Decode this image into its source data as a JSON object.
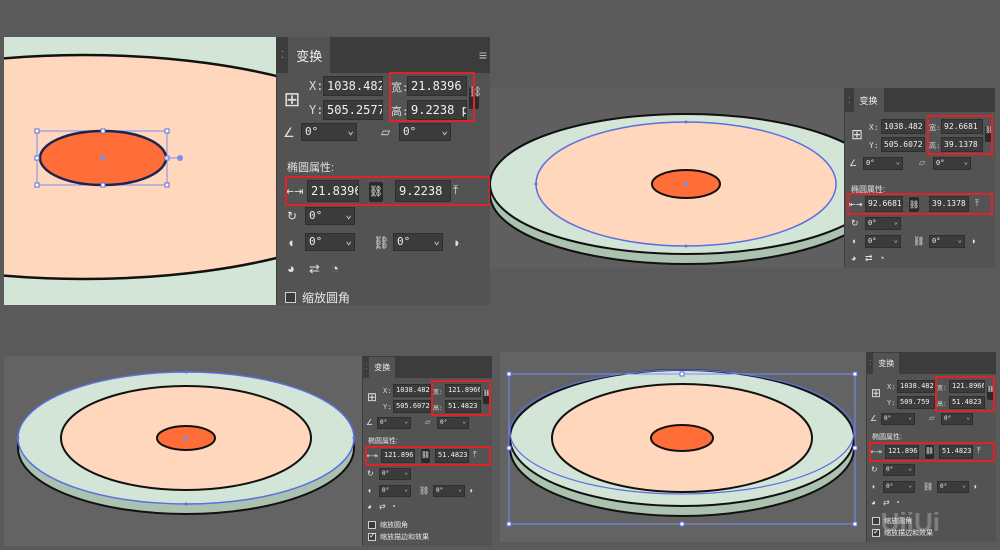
{
  "colors": {
    "canvas": "#686868",
    "disc_top": "#ffd7bc",
    "disc_rim": "#d3e5d6",
    "disc_side": "#aac2ae",
    "inner_ellipse": "#ff6d39",
    "highlight": "#e0232a",
    "panel_bg": "#535353"
  },
  "panel": {
    "title": "变换",
    "x_label": "X:",
    "y_label": "Y:",
    "w_label": "宽:",
    "h_label": "高:",
    "ellipse_props": "椭圆属性:",
    "angle": "0°",
    "shear": "0°",
    "scale_corners": "缩放圆角",
    "scale_strokes": "缩放描边和效果",
    "icons": [
      "reference-point-icon",
      "rotate-icon",
      "chain-link-icon",
      "flip-icon",
      "corner-icon"
    ]
  },
  "step1": {
    "x": "1038.482",
    "y": "505.2577",
    "w": "21.8396",
    "h": "9.2238 p",
    "ew": "21.8396",
    "eh": "9.2238 p"
  },
  "step2": {
    "x": "1038.482",
    "y": "505.6072",
    "w": "92.6681",
    "h": "39.1378",
    "ew": "92.6681",
    "eh": "39.1378"
  },
  "step3": {
    "x": "1038.482",
    "y": "505.6072",
    "w": "121.8966",
    "h": "51.4823",
    "ew": "121.8966",
    "eh": "51.4823"
  },
  "step4": {
    "x": "1038.482",
    "y": "509.759",
    "w": "121.8966",
    "h": "51.4823",
    "ew": "121.8966",
    "eh": "51.4823"
  },
  "watermark": "UiiUi"
}
